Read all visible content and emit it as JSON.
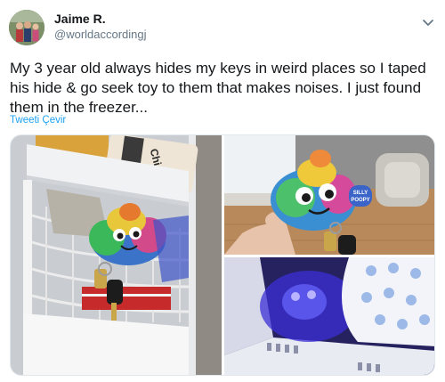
{
  "author": {
    "name": "Jaime R.",
    "handle": "@worldaccordingj",
    "avatar_icon": "profile-photo"
  },
  "tweet": {
    "text": "My 3 year old always hides my keys in weird places so I taped his hide & go seek toy to them that makes noises. I just found them in the freezer...",
    "translate_label": "Tweeti Çevir"
  },
  "icons": {
    "menu": "chevron-down-icon"
  },
  "photos": [
    {
      "label": "photo-freezer-keys"
    },
    {
      "label": "photo-toy-in-hand"
    },
    {
      "label": "photo-toy-glowing"
    }
  ],
  "photo_text": {
    "bag": "Chic",
    "toy_badge_1": "SILLY",
    "toy_badge_2": "POOPY"
  },
  "colors": {
    "link": "#1da1f2",
    "text": "#14171a",
    "muted": "#657786"
  }
}
